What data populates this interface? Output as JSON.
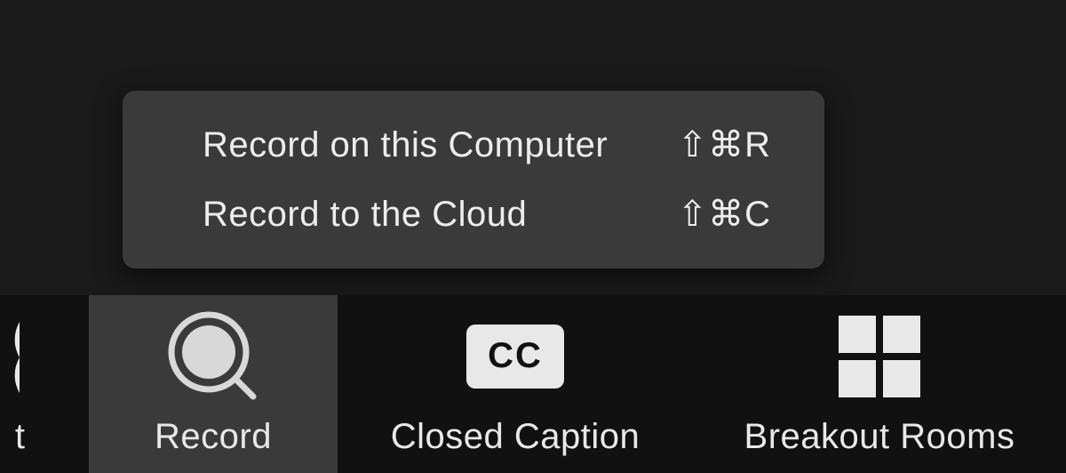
{
  "menu": {
    "items": [
      {
        "label": "Record on this Computer",
        "shortcut": "⇧⌘R"
      },
      {
        "label": "Record to the Cloud",
        "shortcut": "⇧⌘C"
      }
    ]
  },
  "toolbar": {
    "cutoff_label": "t",
    "record_label": "Record",
    "cc_label": "Closed Caption",
    "cc_badge": "CC",
    "breakout_label": "Breakout Rooms"
  }
}
